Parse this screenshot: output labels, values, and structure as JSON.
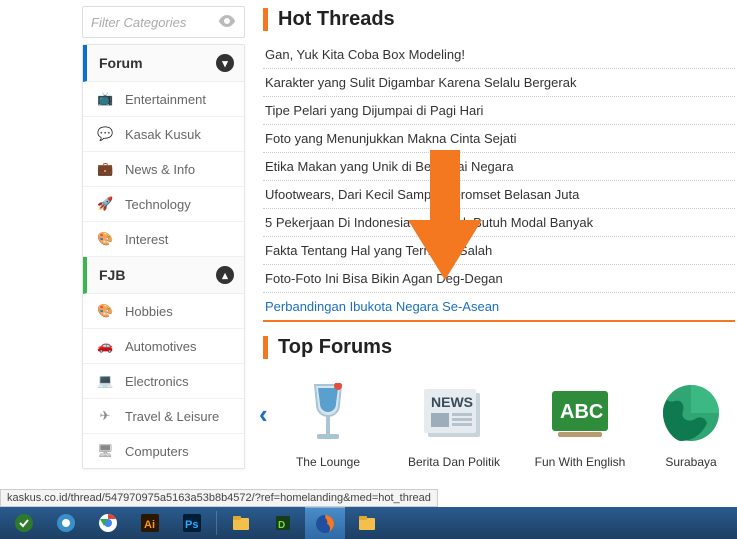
{
  "filter": {
    "placeholder": "Filter Categories"
  },
  "sidebar": {
    "sections": [
      {
        "title": "Forum",
        "style": "blue",
        "collapsed": false,
        "items": [
          {
            "icon": "📺",
            "label": "Entertainment"
          },
          {
            "icon": "💬",
            "label": "Kasak Kusuk"
          },
          {
            "icon": "💼",
            "label": "News & Info"
          },
          {
            "icon": "🚀",
            "label": "Technology"
          },
          {
            "icon": "🎨",
            "label": "Interest"
          }
        ]
      },
      {
        "title": "FJB",
        "style": "green",
        "collapsed": true,
        "items": [
          {
            "icon": "🎨",
            "label": "Hobbies"
          },
          {
            "icon": "🚗",
            "label": "Automotives"
          },
          {
            "icon": "💻",
            "label": "Electronics"
          },
          {
            "icon": "✈",
            "label": "Travel & Leisure"
          },
          {
            "icon": "🖥",
            "label": "Computers"
          }
        ]
      }
    ]
  },
  "hot_threads": {
    "title": "Hot Threads",
    "items": [
      "Gan, Yuk Kita Coba Box Modeling!",
      "Karakter yang Sulit Digambar Karena Selalu Bergerak",
      "Tipe Pelari yang Dijumpai di Pagi Hari",
      "Foto yang Menunjukkan Makna Cinta Sejati",
      "Etika Makan yang Unik di Berbagai Negara",
      "Ufootwears, Dari Kecil Sampai Beromset Belasan Juta",
      "5 Pekerjaan Di Indonesia yang Gak Butuh Modal Banyak",
      "Fakta Tentang Hal yang Ternyata Salah",
      "Foto-Foto Ini Bisa Bikin Agan Deg-Degan",
      "Perbandingan Ibukota Negara Se-Asean"
    ],
    "highlight_index": 9
  },
  "top_forums": {
    "title": "Top Forums",
    "items": [
      {
        "label": "The Lounge",
        "icon": "wine"
      },
      {
        "label": "Berita Dan Politik",
        "icon": "news"
      },
      {
        "label": "Fun With English",
        "icon": "abc"
      },
      {
        "label": "Surabaya",
        "icon": "globe"
      }
    ]
  },
  "status_url": "kaskus.co.id/thread/547970975a5163a53b8b4572/?ref=homelanding&med=hot_thread",
  "taskbar": {
    "items": [
      {
        "name": "idm",
        "active": false
      },
      {
        "name": "camtasia",
        "active": false
      },
      {
        "name": "chrome",
        "active": false
      },
      {
        "name": "illustrator",
        "active": false
      },
      {
        "name": "photoshop",
        "active": false
      },
      {
        "name": "separator",
        "active": false
      },
      {
        "name": "explorer",
        "active": false
      },
      {
        "name": "dreamweaver",
        "active": false
      },
      {
        "name": "firefox",
        "active": true
      },
      {
        "name": "folder",
        "active": false
      }
    ]
  }
}
